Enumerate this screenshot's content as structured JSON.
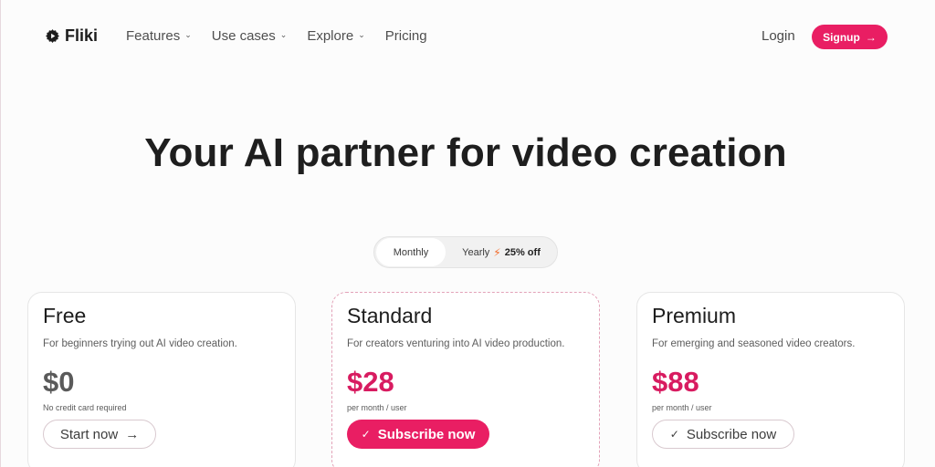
{
  "brand": {
    "name": "Fliki",
    "icon": "gear-play-icon"
  },
  "nav": {
    "links": [
      {
        "label": "Features",
        "has_dropdown": true
      },
      {
        "label": "Use cases",
        "has_dropdown": true
      },
      {
        "label": "Explore",
        "has_dropdown": true
      },
      {
        "label": "Pricing",
        "has_dropdown": false
      }
    ],
    "login_label": "Login",
    "signup_label": "Signup",
    "signup_icon": "arrow-right-icon"
  },
  "hero": {
    "title": "Your AI partner for video creation"
  },
  "billing": {
    "monthly_label": "Monthly",
    "yearly_label": "Yearly",
    "discount_icon": "bolt-icon",
    "discount_label": "25% off",
    "selected": "Monthly"
  },
  "plans": [
    {
      "name": "Free",
      "description": "For beginners trying out AI video creation.",
      "price": "$0",
      "note": "No credit card required",
      "button_label": "Start now",
      "button_icon": "arrow-right-icon"
    },
    {
      "name": "Standard",
      "description": "For creators venturing into AI video production.",
      "price": "$28",
      "note": "per month / user",
      "button_label": "Subscribe now",
      "button_icon": "check-icon",
      "highlighted": true
    },
    {
      "name": "Premium",
      "description": "For emerging and seasoned video creators.",
      "price": "$88",
      "note": "per month / user",
      "button_label": "Subscribe now",
      "button_icon": "check-icon"
    }
  ],
  "colors": {
    "accent": "#e91e63",
    "price_accent": "#d81b60",
    "bolt": "#f26b2a"
  },
  "glyphs": {
    "chevron": "⌄",
    "arrow": "→",
    "check": "✓",
    "bolt": "⚡"
  }
}
